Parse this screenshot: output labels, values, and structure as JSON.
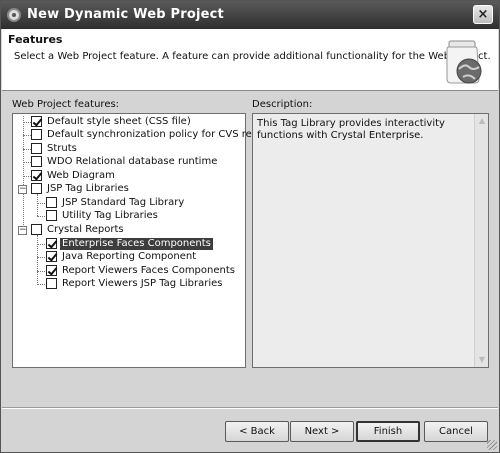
{
  "window": {
    "title": "New Dynamic Web Project",
    "close_label": "×"
  },
  "banner": {
    "title": "Features",
    "description": "Select a Web Project feature.  A feature can provide additional functionality for the Web Project.",
    "icon": "web-project-jar-globe-icon"
  },
  "features": {
    "label": "Web Project features:",
    "items": [
      {
        "label": "Default style sheet (CSS file)",
        "checked": true
      },
      {
        "label": "Default synchronization policy for CVS repository",
        "checked": false
      },
      {
        "label": "Struts",
        "checked": false
      },
      {
        "label": "WDO Relational database runtime",
        "checked": false
      },
      {
        "label": "Web Diagram",
        "checked": true
      },
      {
        "label": "JSP Tag Libraries",
        "checked": false,
        "expander": "−"
      },
      {
        "label": "JSP Standard Tag Library",
        "checked": false
      },
      {
        "label": "Utility Tag Libraries",
        "checked": false
      },
      {
        "label": "Crystal Reports",
        "checked": false,
        "expander": "−"
      },
      {
        "label": "Enterprise Faces Components",
        "checked": true,
        "selected": true
      },
      {
        "label": "Java Reporting Component",
        "checked": true
      },
      {
        "label": "Report Viewers Faces Components",
        "checked": true
      },
      {
        "label": "Report Viewers JSP Tag Libraries",
        "checked": false
      }
    ]
  },
  "description": {
    "label": "Description:",
    "text": "This Tag Library provides interactivity functions with Crystal Enterprise."
  },
  "buttons": {
    "back": "< Back",
    "next": "Next >",
    "finish": "Finish",
    "cancel": "Cancel"
  }
}
